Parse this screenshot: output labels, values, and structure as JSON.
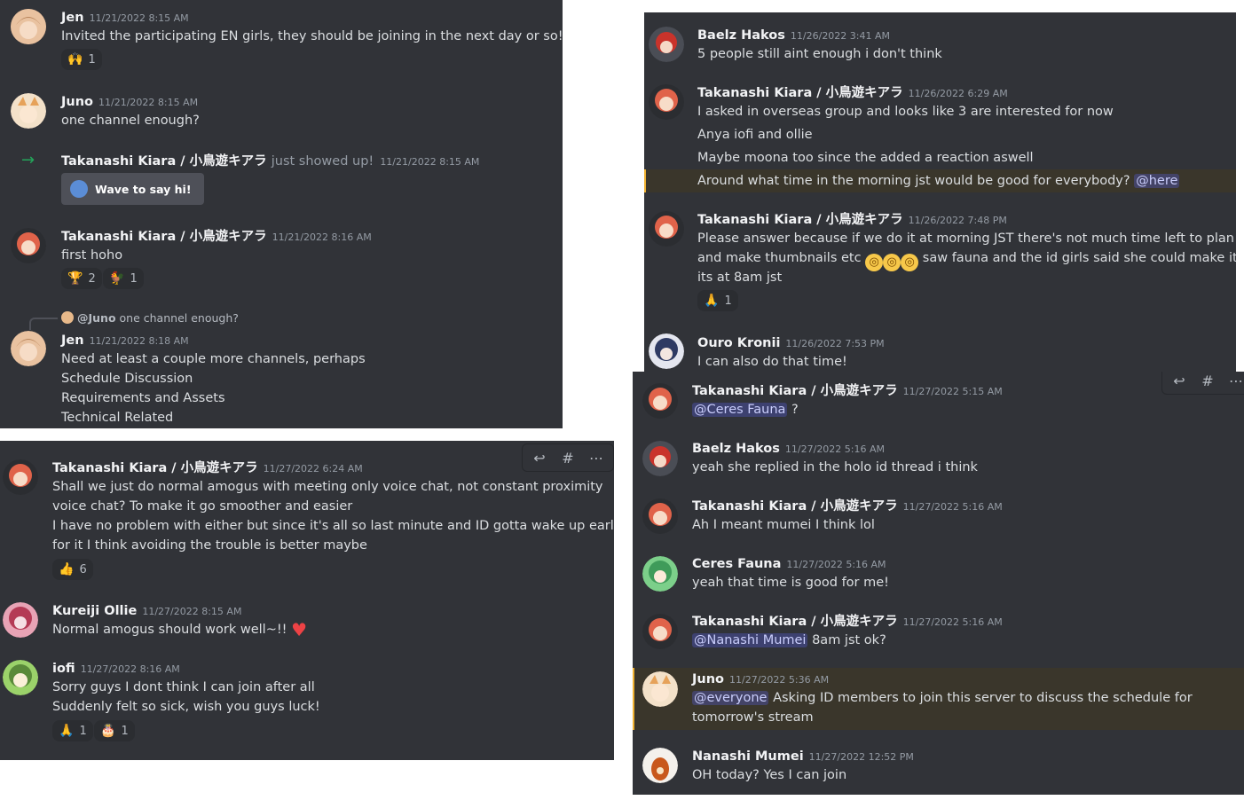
{
  "colors": {
    "bg": "#313338",
    "mention": "#c9cdfb",
    "highlight": "#f0b232",
    "arrow": "#23a55a"
  },
  "panel1": {
    "m1": {
      "name": "Jen",
      "ts": "11/21/2022 8:15 AM",
      "text": "Invited the participating EN girls, they should be joining in the next day or so!",
      "rxn": {
        "emoji": "🙌",
        "count": "1"
      }
    },
    "m2": {
      "name": "Juno",
      "ts": "11/21/2022 8:15 AM",
      "text": "one channel enough?"
    },
    "m3": {
      "name": "Takanashi Kiara / 小鳥遊キアラ",
      "action": "just showed up!",
      "ts": "11/21/2022 8:15 AM",
      "button": "Wave to say hi!"
    },
    "m4": {
      "name": "Takanashi Kiara / 小鳥遊キアラ",
      "ts": "11/21/2022 8:16 AM",
      "text": "first hoho",
      "rxn1": {
        "emoji": "🏆",
        "count": "2"
      },
      "rxn2": {
        "emoji": "🐓",
        "count": "1"
      }
    },
    "m5": {
      "reply_name": "@Juno",
      "reply_text": "one channel enough?",
      "name": "Jen",
      "ts": "11/21/2022 8:18 AM",
      "lines": [
        "Need at least a couple more channels, perhaps",
        "Schedule Discussion",
        "Requirements and Assets",
        "Technical Related"
      ]
    }
  },
  "panel2": {
    "m1": {
      "name": "Baelz Hakos",
      "ts": "11/26/2022 3:41 AM",
      "text": "5 people still aint enough i don't think"
    },
    "m2": {
      "name": "Takanashi Kiara / 小鳥遊キアラ",
      "ts": "11/26/2022 6:29 AM",
      "lines": [
        "I asked in overseas group and looks like 3 are interested for now",
        "Anya iofi and ollie",
        "Maybe moona too since the added a reaction aswell"
      ],
      "hl_text": "Around what time in the morning jst would be good for everybody?",
      "mention": "@here"
    },
    "m3": {
      "name": "Takanashi Kiara / 小鳥遊キアラ",
      "ts": "11/26/2022 7:48 PM",
      "line1": "Please answer because if we do it at morning JST there's not much time left to plan",
      "line2a": "and make thumbnails etc",
      "line2b": "saw fauna and the id girls said she could make it if",
      "line3": "its at 8am jst",
      "rxn": {
        "emoji": "🙏",
        "count": "1"
      }
    },
    "m4": {
      "name": "Ouro Kronii",
      "ts": "11/26/2022 7:53 PM",
      "text": "I can also do that time!"
    }
  },
  "panel3": {
    "m1": {
      "name": "Takanashi Kiara / 小鳥遊キアラ",
      "ts": "11/27/2022 5:15 AM",
      "mention": "@Ceres Fauna",
      "text": "?"
    },
    "m2": {
      "name": "Baelz Hakos",
      "ts": "11/27/2022 5:16 AM",
      "text": "yeah she replied in the holo id thread i think"
    },
    "m3": {
      "name": "Takanashi Kiara / 小鳥遊キアラ",
      "ts": "11/27/2022 5:16 AM",
      "text": "Ah I meant mumei I think lol"
    },
    "m4": {
      "name": "Ceres Fauna",
      "ts": "11/27/2022 5:16 AM",
      "text": "yeah that time is good for me!"
    },
    "m5": {
      "name": "Takanashi Kiara / 小鳥遊キアラ",
      "ts": "11/27/2022 5:16 AM",
      "mention": "@Nanashi Mumei",
      "text": "8am jst ok?"
    },
    "m6": {
      "name": "Juno",
      "ts": "11/27/2022 5:36 AM",
      "mention": "@everyone",
      "text": "Asking ID members to join this server to discuss the schedule for",
      "line2": "tomorrow's stream"
    },
    "m7": {
      "name": "Nanashi Mumei",
      "ts": "11/27/2022 12:52 PM",
      "text": "OH today? Yes I can join"
    }
  },
  "panel4": {
    "m1": {
      "name": "Takanashi Kiara / 小鳥遊キアラ",
      "ts": "11/27/2022 6:24 AM",
      "lines": [
        "Shall we just do normal amogus with meeting only voice chat, not constant proximity",
        "voice chat? To make it go smoother and easier",
        "I have no problem with either but since it's all so last minute and ID gotta wake up early",
        "for it I think avoiding the trouble is better maybe"
      ],
      "rxn": {
        "emoji": "👍",
        "count": "6"
      }
    },
    "m2": {
      "name": "Kureiji Ollie",
      "ts": "11/27/2022 8:15 AM",
      "text": "Normal amogus should work well~!!"
    },
    "m3": {
      "name": "iofi",
      "ts": "11/27/2022 8:16 AM",
      "lines": [
        "Sorry guys I dont think I can join after all",
        "Suddenly felt so sick, wish you guys luck!"
      ],
      "rxn1": {
        "emoji": "🙏",
        "count": "1"
      },
      "rxn2": {
        "emoji": "🎂",
        "count": "1"
      }
    }
  }
}
